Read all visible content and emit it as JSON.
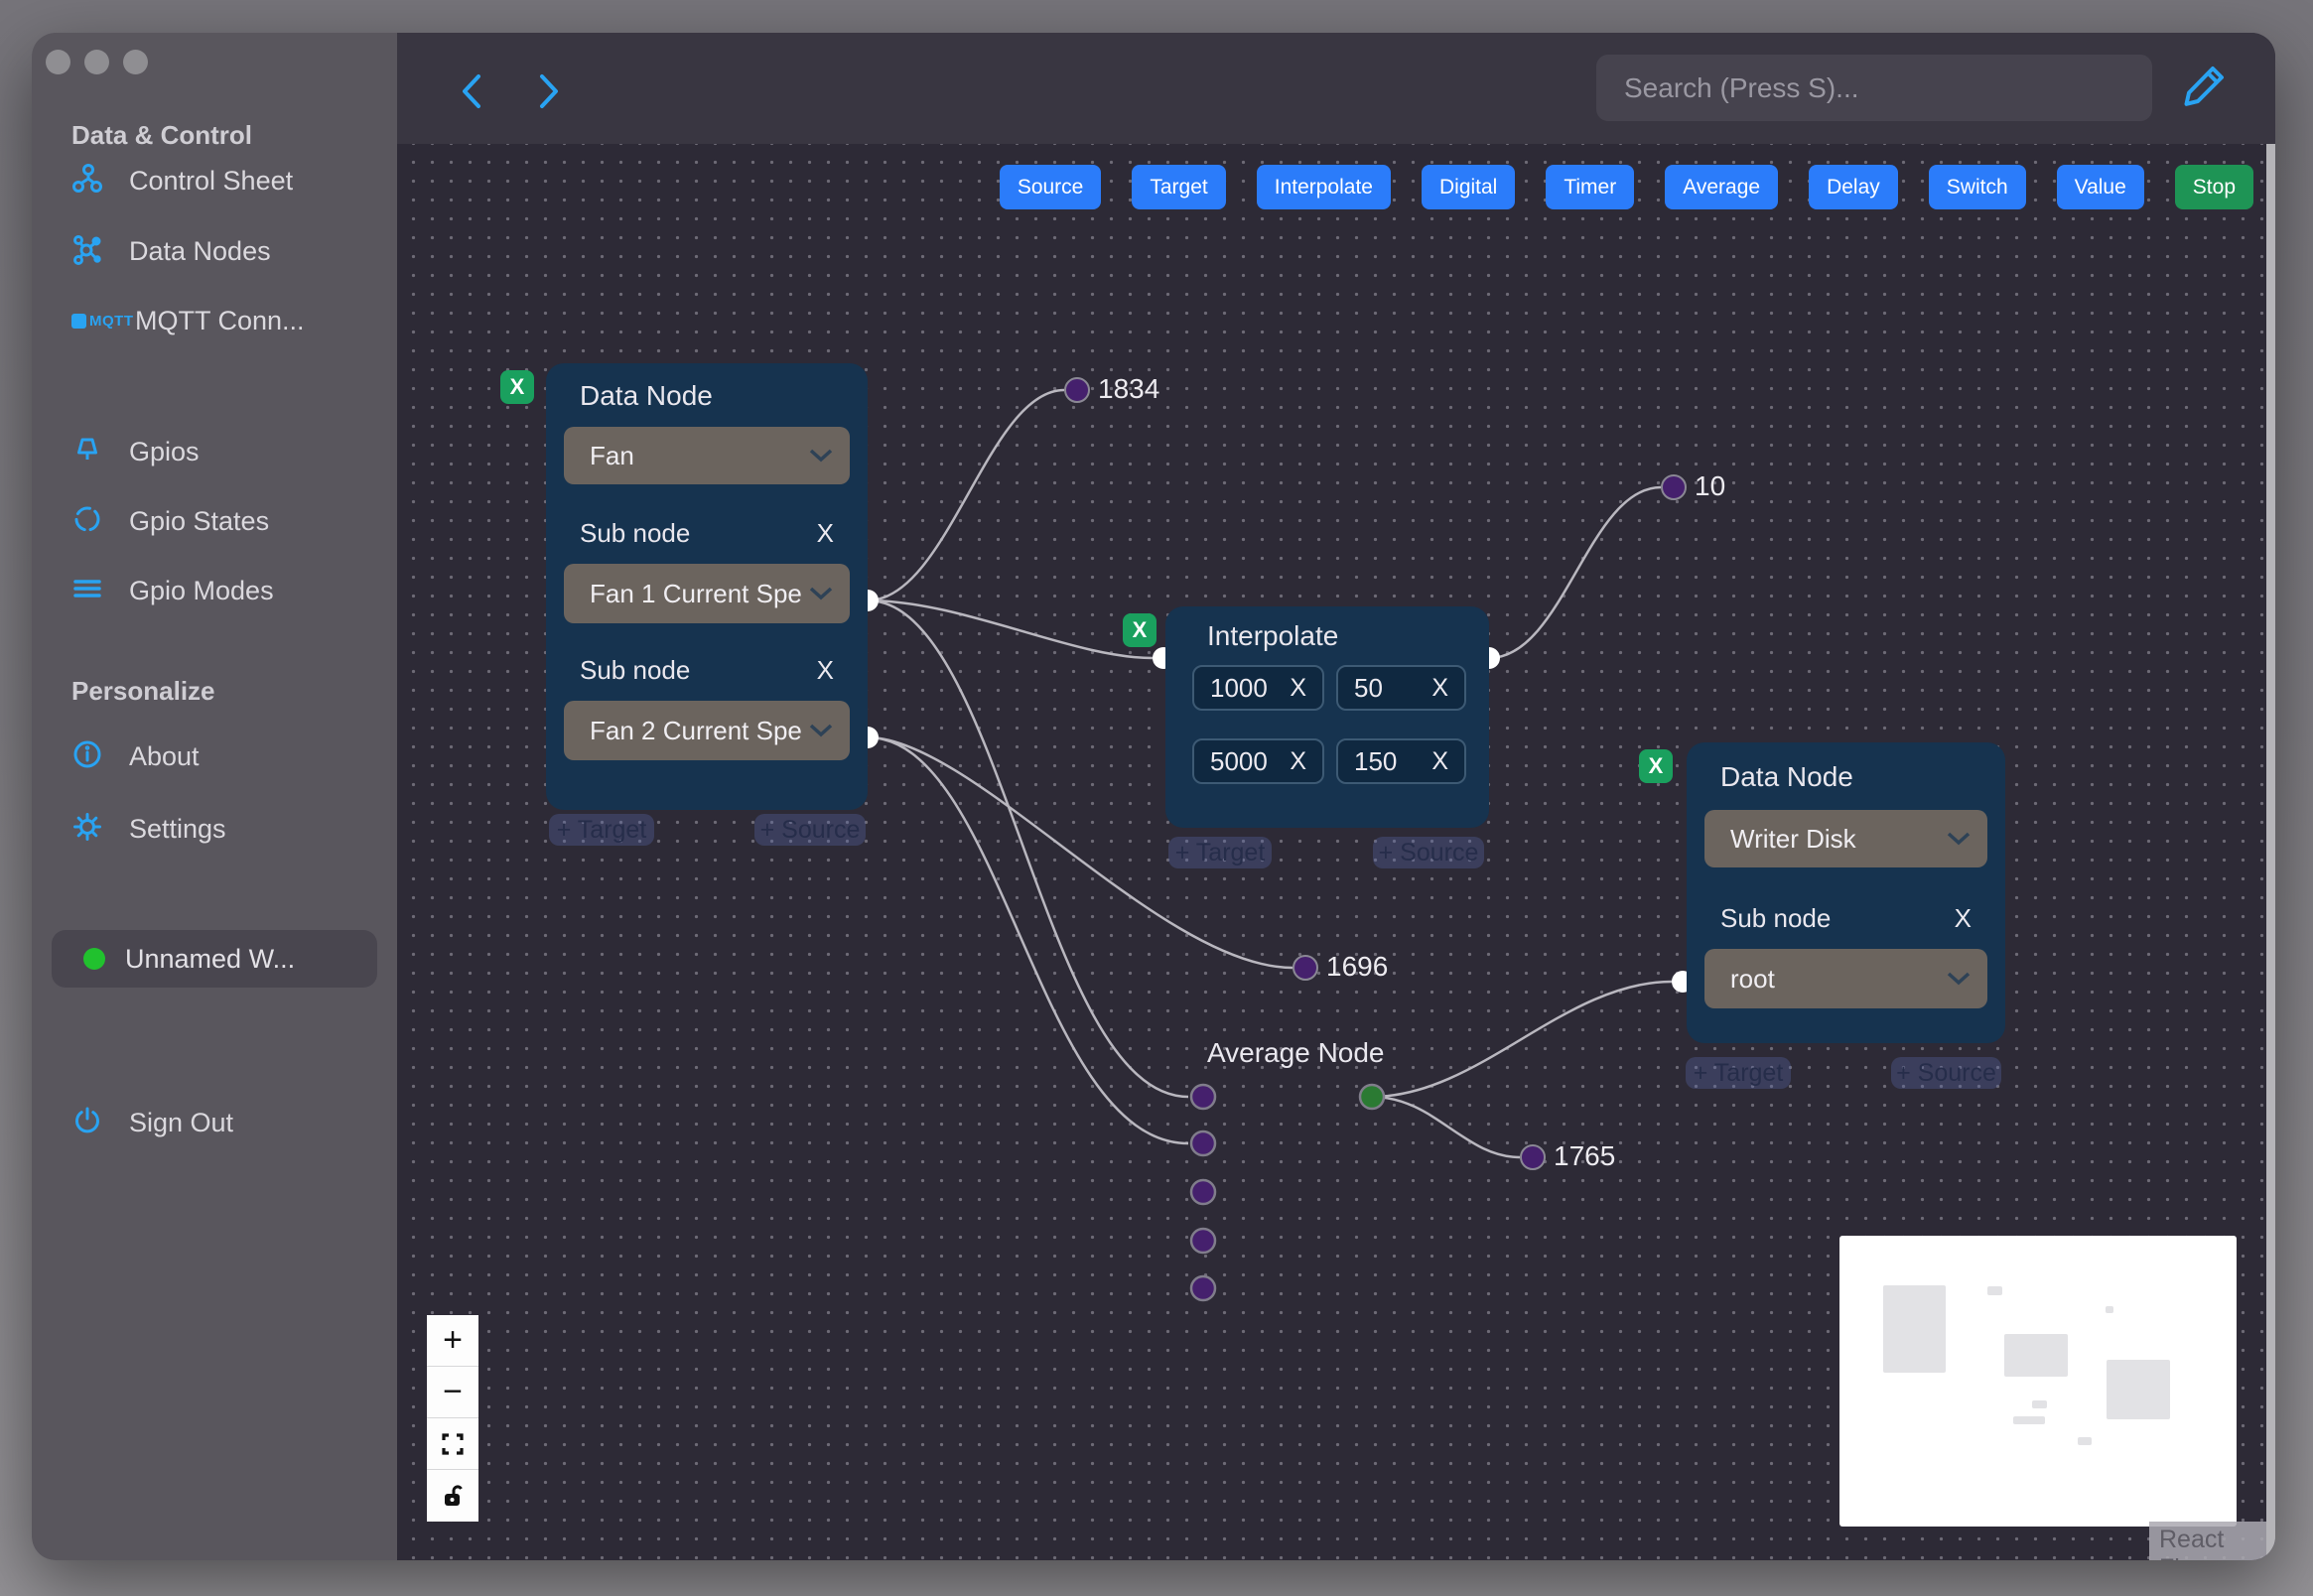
{
  "window": {
    "title_dots": 3
  },
  "sidebar": {
    "group1_title": "Data & Control",
    "group1": [
      {
        "label": "Control Sheet"
      },
      {
        "label": "Data Nodes"
      },
      {
        "label": "MQTT Conn..."
      }
    ],
    "mqtt_logo_text": "MQTT",
    "group2": [
      {
        "label": "Gpios"
      },
      {
        "label": "Gpio States"
      },
      {
        "label": "Gpio Modes"
      }
    ],
    "group3_title": "Personalize",
    "group3": [
      {
        "label": "About"
      },
      {
        "label": "Settings"
      }
    ],
    "workspace_label": "Unnamed W...",
    "signout_label": "Sign Out"
  },
  "topbar": {
    "search_placeholder": "Search (Press S)..."
  },
  "toolbar": {
    "buttons": [
      {
        "label": "Source"
      },
      {
        "label": "Target"
      },
      {
        "label": "Interpolate"
      },
      {
        "label": "Digital"
      },
      {
        "label": "Timer"
      },
      {
        "label": "Average"
      },
      {
        "label": "Delay"
      },
      {
        "label": "Switch"
      },
      {
        "label": "Value"
      },
      {
        "label": "Stop"
      }
    ]
  },
  "flow": {
    "remove_x": "X",
    "badge_x": "X",
    "pill_target": "+ Target",
    "pill_source": "+ Source",
    "fan_node": {
      "title": "Data Node",
      "type_value": "Fan",
      "sub1_label": "Sub node",
      "sub1_value": "Fan 1 Current Spe",
      "sub2_label": "Sub node",
      "sub2_value": "Fan 2 Current Spe"
    },
    "interpolate_node": {
      "title": "Interpolate",
      "values": [
        {
          "v": "1000"
        },
        {
          "v": "50"
        },
        {
          "v": "5000"
        },
        {
          "v": "150"
        }
      ]
    },
    "writer_node": {
      "title": "Data Node",
      "type_value": "Writer Disk",
      "sub_label": "Sub node",
      "sub_value": "root"
    },
    "average_label": "Average Node",
    "edge_values": [
      {
        "v": "1834"
      },
      {
        "v": "10"
      },
      {
        "v": "1696"
      },
      {
        "v": "1765"
      }
    ]
  },
  "controls": {
    "zoom_in": "+",
    "zoom_out": "−"
  },
  "attribution": "React Flow",
  "colors": {
    "accent_blue": "#2b7cfa",
    "icon_blue": "#29a3f2",
    "node_navy": "#16334f",
    "green": "#1aa05e",
    "stop_green": "#1e9455",
    "handle_purple": "#45206d",
    "handle_green": "#2b7a33",
    "canvas_bg": "#2d2a36",
    "sidebar_bg": "#59565d"
  }
}
